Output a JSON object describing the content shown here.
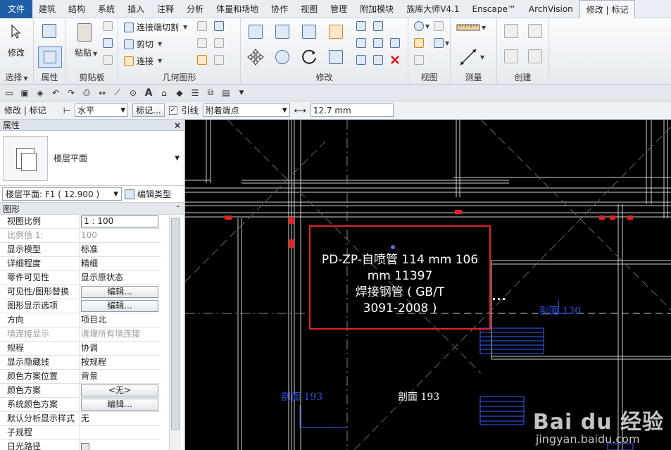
{
  "menu": {
    "tabs": [
      "文件",
      "建筑",
      "结构",
      "系统",
      "插入",
      "注释",
      "分析",
      "体量和场地",
      "协作",
      "视图",
      "管理",
      "附加模块",
      "族库大师V4.1",
      "Enscape™",
      "ArchVision",
      "修改 | 标记"
    ]
  },
  "ribbon": {
    "modify_label": "修改",
    "paste_label": "粘贴",
    "cope_label": "连接端切割",
    "cut_label": "剪切",
    "join_label": "连接",
    "panels": {
      "select": "选择",
      "properties": "属性",
      "clipboard": "剪贴板",
      "geometry": "几何图形",
      "modify": "修改",
      "view": "视图",
      "measure": "测量",
      "create": "创建"
    }
  },
  "optionsbar": {
    "context_label": "修改 | 标记",
    "orientation": "水平",
    "tag_button": "标记...",
    "leader_checked": true,
    "leader_label": "引线",
    "leader_type": "附着端点",
    "length": "12.7 mm"
  },
  "properties": {
    "title": "属性",
    "close": "×",
    "type_name": "楼层平面",
    "instance_selector": "楼层平面: F1 ( 12.900 )",
    "edit_type": "编辑类型",
    "section": "图形",
    "rows": [
      {
        "label": "视图比例",
        "value": "1 : 100",
        "kind": "input"
      },
      {
        "label": "比例值 1:",
        "value": "100",
        "kind": "gray"
      },
      {
        "label": "显示模型",
        "value": "标准",
        "kind": "text"
      },
      {
        "label": "详细程度",
        "value": "精细",
        "kind": "text"
      },
      {
        "label": "零件可见性",
        "value": "显示原状态",
        "kind": "text"
      },
      {
        "label": "可见性/图形替换",
        "value": "编辑...",
        "kind": "button"
      },
      {
        "label": "图形显示选项",
        "value": "编辑...",
        "kind": "button"
      },
      {
        "label": "方向",
        "value": "项目北",
        "kind": "text"
      },
      {
        "label": "墙连接显示",
        "value": "清理所有墙连接",
        "kind": "gray"
      },
      {
        "label": "规程",
        "value": "协调",
        "kind": "text"
      },
      {
        "label": "显示隐藏线",
        "value": "按规程",
        "kind": "text"
      },
      {
        "label": "颜色方案位置",
        "value": "背景",
        "kind": "text"
      },
      {
        "label": "颜色方案",
        "value": "<无>",
        "kind": "button"
      },
      {
        "label": "系统颜色方案",
        "value": "编辑...",
        "kind": "button"
      },
      {
        "label": "默认分析显示样式",
        "value": "无",
        "kind": "text"
      },
      {
        "label": "子规程",
        "value": "",
        "kind": "text"
      },
      {
        "label": "日光路径",
        "value": "",
        "kind": "check"
      }
    ]
  },
  "canvas": {
    "tag_lines": [
      "PD-ZP-自喷管 114 mm 106",
      "mm 11397",
      "焊接钢管 ( GB/T",
      "3091-2008 )"
    ],
    "section_labels": [
      {
        "text": "剖面 130",
        "color": "#2c4fd6"
      },
      {
        "text": "剖面 193",
        "color": "#2c4fd6"
      },
      {
        "text": "剖面 193",
        "color": "#ffffff"
      }
    ],
    "watermark_main": "Bai du 经验",
    "watermark_sub": "jingyan.baidu.com"
  }
}
